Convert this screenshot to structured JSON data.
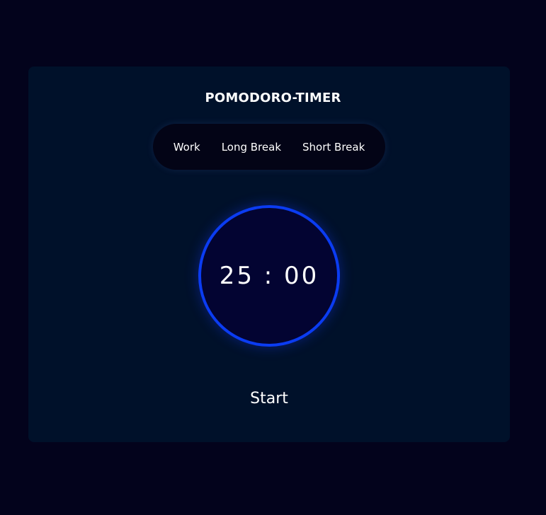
{
  "app": {
    "title": "POMODORO-TIMER"
  },
  "modes": {
    "work_label": "Work",
    "long_break_label": "Long Break",
    "short_break_label": "Short Break"
  },
  "timer": {
    "display": "25 : 00"
  },
  "controls": {
    "start_label": "Start"
  },
  "colors": {
    "page_background": "#03031c",
    "card_background": "#00112a",
    "mode_bar_background": "#030416",
    "ring_accent": "#0b3cf2",
    "ring_fill": "#030432",
    "text": "#ffffff"
  }
}
